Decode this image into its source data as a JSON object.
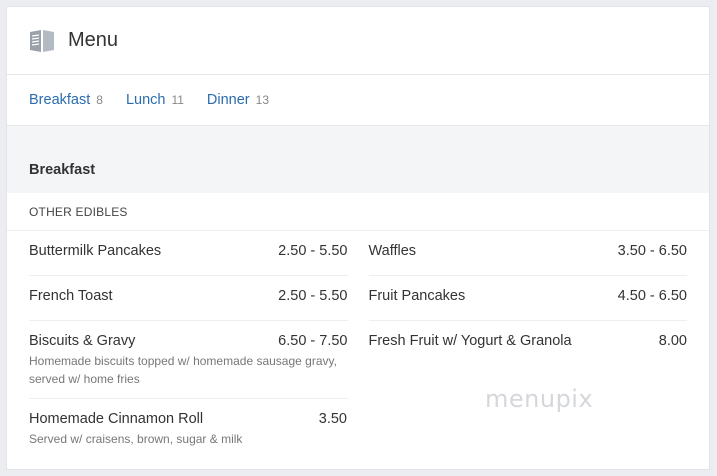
{
  "header": {
    "title": "Menu",
    "icon": "book-icon"
  },
  "tabs": [
    {
      "label": "Breakfast",
      "count": "8"
    },
    {
      "label": "Lunch",
      "count": "11"
    },
    {
      "label": "Dinner",
      "count": "13"
    }
  ],
  "section": {
    "title": "Breakfast"
  },
  "group": {
    "title": "OTHER EDIBLES"
  },
  "left_items": [
    {
      "name": "Buttermilk Pancakes",
      "price": "2.50 - 5.50",
      "desc": ""
    },
    {
      "name": "French Toast",
      "price": "2.50 - 5.50",
      "desc": ""
    },
    {
      "name": "Biscuits & Gravy",
      "price": "6.50 - 7.50",
      "desc": "Homemade biscuits topped w/ homemade sausage gravy, served w/ home fries"
    },
    {
      "name": "Homemade Cinnamon Roll",
      "price": "3.50",
      "desc": "Served w/ craisens, brown, sugar & milk"
    }
  ],
  "right_items": [
    {
      "name": "Waffles",
      "price": "3.50 - 6.50",
      "desc": ""
    },
    {
      "name": "Fruit Pancakes",
      "price": "4.50 - 6.50",
      "desc": ""
    },
    {
      "name": "Fresh Fruit w/ Yogurt & Granola",
      "price": "8.00",
      "desc": ""
    }
  ],
  "watermark": "menupix",
  "colors": {
    "link": "#2b6cb0",
    "band": "#f4f5f7",
    "background": "#ecedf0"
  }
}
